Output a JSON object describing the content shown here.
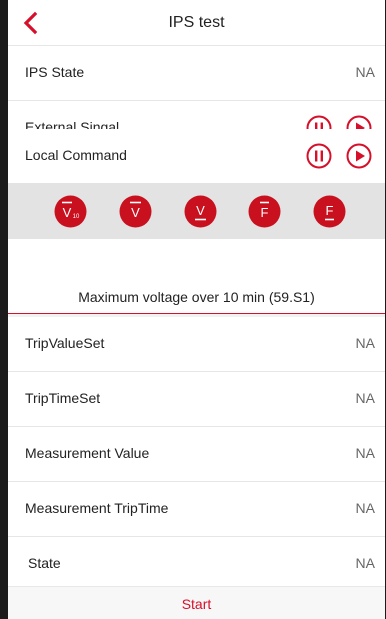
{
  "header": {
    "title": "IPS test",
    "back_icon": "chevron-left-icon"
  },
  "controls": [
    {
      "label": "IPS State",
      "value": "NA"
    },
    {
      "label": "External Singal",
      "icons": [
        "pause-icon",
        "play-icon"
      ]
    },
    {
      "label": "Local Command",
      "icons": [
        "pause-icon",
        "play-icon"
      ]
    }
  ],
  "function_tabs": {
    "items": [
      {
        "symbol": "V",
        "subscript": "10",
        "mark": "bar-over",
        "icon": "v10-max-icon"
      },
      {
        "symbol": "V",
        "mark": "bar-over",
        "icon": "v-max-icon"
      },
      {
        "symbol": "V",
        "mark": "bar-under",
        "icon": "v-min-icon"
      },
      {
        "symbol": "F",
        "mark": "bar-over",
        "icon": "f-max-icon"
      },
      {
        "symbol": "F",
        "mark": "bar-under",
        "icon": "f-min-icon"
      }
    ],
    "description": "Maximum voltage over 10 min (59.S1)"
  },
  "results": [
    {
      "label": "TripValueSet",
      "value": "NA"
    },
    {
      "label": "TripTimeSet",
      "value": "NA"
    },
    {
      "label": "Measurement Value",
      "value": "NA"
    },
    {
      "label": "Measurement TripTime",
      "value": "NA"
    },
    {
      "label": "State",
      "value": "NA"
    }
  ],
  "footer": {
    "start_label": "Start"
  },
  "colors": {
    "accent": "#d6102a",
    "background": "#f2f2f2",
    "text": "#222222"
  }
}
